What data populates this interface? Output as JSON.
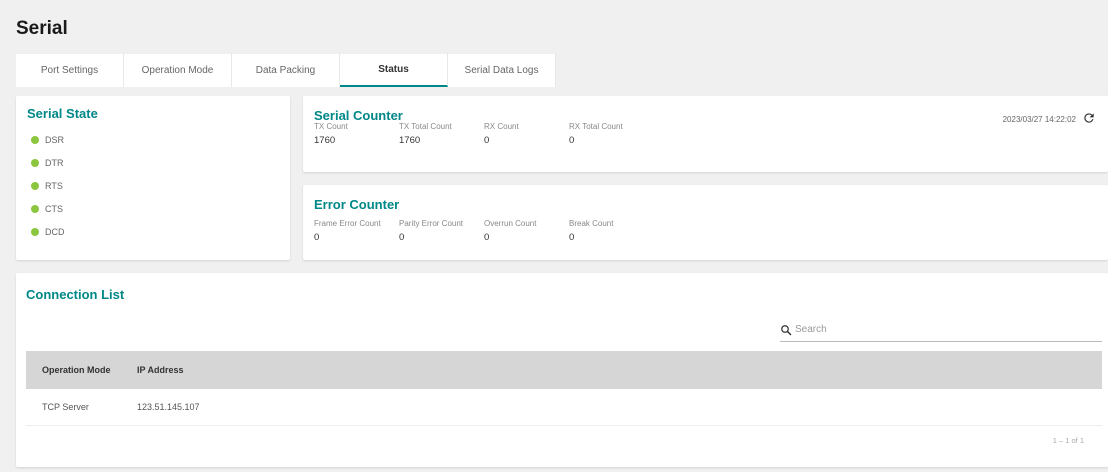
{
  "page_title": "Serial",
  "tabs": [
    {
      "label": "Port Settings"
    },
    {
      "label": "Operation Mode"
    },
    {
      "label": "Data Packing"
    },
    {
      "label": "Status"
    },
    {
      "label": "Serial Data Logs"
    }
  ],
  "serial_state": {
    "title": "Serial State",
    "items": [
      {
        "label": "DSR",
        "status_color": "#8cc63e"
      },
      {
        "label": "DTR",
        "status_color": "#8cc63e"
      },
      {
        "label": "RTS",
        "status_color": "#8cc63e"
      },
      {
        "label": "CTS",
        "status_color": "#8cc63e"
      },
      {
        "label": "DCD",
        "status_color": "#8cc63e"
      }
    ]
  },
  "serial_counter": {
    "title": "Serial Counter",
    "timestamp": "2023/03/27 14:22:02",
    "counters": [
      {
        "label": "TX Count",
        "value": "1760"
      },
      {
        "label": "TX Total Count",
        "value": "1760"
      },
      {
        "label": "RX Count",
        "value": "0"
      },
      {
        "label": "RX Total Count",
        "value": "0"
      }
    ]
  },
  "error_counter": {
    "title": "Error Counter",
    "counters": [
      {
        "label": "Frame Error Count",
        "value": "0"
      },
      {
        "label": "Parity Error Count",
        "value": "0"
      },
      {
        "label": "Overrun Count",
        "value": "0"
      },
      {
        "label": "Break Count",
        "value": "0"
      }
    ]
  },
  "connection_list": {
    "title": "Connection List",
    "search_placeholder": "Search",
    "columns": [
      "Operation Mode",
      "IP Address"
    ],
    "rows": [
      [
        "TCP Server",
        "123.51.145.107"
      ]
    ],
    "pagination": "1 – 1 of 1"
  },
  "colors": {
    "accent": "#008787",
    "status_ok": "#8cc63e"
  }
}
